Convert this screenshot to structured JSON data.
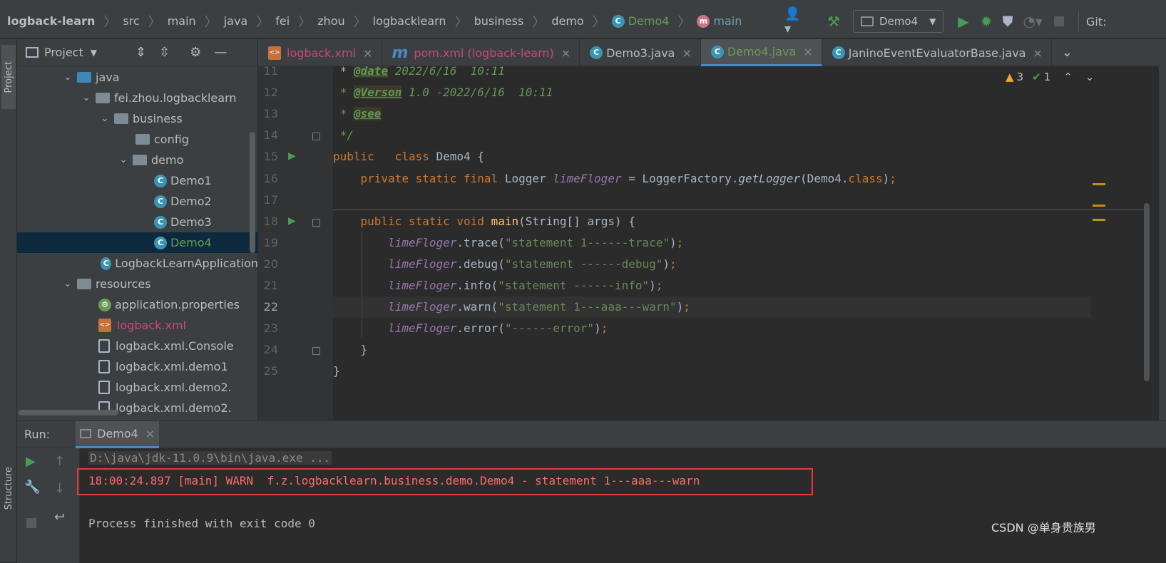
{
  "breadcrumb": {
    "items": [
      "logback-learn",
      "src",
      "main",
      "java",
      "fei",
      "zhou",
      "logbacklearn",
      "business",
      "demo"
    ],
    "class": "Demo4",
    "method": "main"
  },
  "toolbar": {
    "run_config": "Demo4",
    "git_label": "Git:"
  },
  "left_strip": {
    "project_label": "Project",
    "structure_label": "Structure"
  },
  "project": {
    "title": "Project",
    "tree": [
      {
        "label": "java",
        "kind": "folder-blue",
        "depth": 0,
        "expanded": true
      },
      {
        "label": "fei.zhou.logbacklearn",
        "kind": "package",
        "depth": 1,
        "expanded": true
      },
      {
        "label": "business",
        "kind": "package",
        "depth": 2,
        "expanded": true
      },
      {
        "label": "config",
        "kind": "package",
        "depth": 3
      },
      {
        "label": "demo",
        "kind": "package",
        "depth": 3,
        "expanded": true
      },
      {
        "label": "Demo1",
        "kind": "class",
        "depth": 4
      },
      {
        "label": "Demo2",
        "kind": "class",
        "depth": 4
      },
      {
        "label": "Demo3",
        "kind": "class",
        "depth": 4
      },
      {
        "label": "Demo4",
        "kind": "class",
        "depth": 4,
        "selected": true
      },
      {
        "label": "LogbackLearnApplication",
        "kind": "appclass",
        "depth": 2
      },
      {
        "label": "resources",
        "kind": "folder",
        "depth": 0,
        "expanded": true
      },
      {
        "label": "application.properties",
        "kind": "props",
        "depth": 1
      },
      {
        "label": "logback.xml",
        "kind": "xml",
        "depth": 1
      },
      {
        "label": "logback.xml.Console",
        "kind": "file",
        "depth": 1
      },
      {
        "label": "logback.xml.demo1",
        "kind": "file",
        "depth": 1
      },
      {
        "label": "logback.xml.demo2.",
        "kind": "file",
        "depth": 1
      },
      {
        "label": "logback.xml.demo2.",
        "kind": "file",
        "depth": 1
      }
    ]
  },
  "tabs": [
    {
      "label": "logback.xml",
      "kind": "xml"
    },
    {
      "label": "pom.xml (logback-learn)",
      "kind": "maven"
    },
    {
      "label": "Demo3.java",
      "kind": "class"
    },
    {
      "label": "Demo4.java",
      "kind": "class",
      "active": true
    },
    {
      "label": "JaninoEventEvaluatorBase.java",
      "kind": "class"
    }
  ],
  "inspections": {
    "warnings": "3",
    "ok": "1"
  },
  "code_lines": [
    {
      "n": "11",
      "html": " * <span class='tag'>@date</span><span class='cm'> 2022/6/16  10:11</span>"
    },
    {
      "n": "12",
      "html": "<span class='cm'> * </span><span class='tag'>@Verson</span><span class='cm'> 1.0 -2022/6/16  10:11</span>"
    },
    {
      "n": "13",
      "html": "<span class='cm'> * </span><span class='tag'>@see</span>"
    },
    {
      "n": "14",
      "html": "<span class='cm'> */</span>"
    },
    {
      "n": "15",
      "html": "<span class='kw'>public</span>   <span class='kw'>class</span> Demo4 {"
    },
    {
      "n": "16",
      "html": "    <span class='kw'>private static final</span> Logger <span class='fld'>limeFloger</span> = LoggerFactory.<span class='stat'>getLogger</span>(Demo4.<span class='kw'>class</span>)<span class='kw'>;</span>"
    },
    {
      "n": "17",
      "html": ""
    },
    {
      "n": "18",
      "html": "    <span class='kw'>public static void</span> <span class='mth'>main</span>(String[] args) {"
    },
    {
      "n": "19",
      "html": "        <span class='fld'>limeFloger</span>.trace(<span class='str'>\"statement 1------trace\"</span>)<span class='kw'>;</span>"
    },
    {
      "n": "20",
      "html": "        <span class='fld'>limeFloger</span>.debug(<span class='str'>\"statement ------debug\"</span>)<span class='kw'>;</span>"
    },
    {
      "n": "21",
      "html": "        <span class='fld'>limeFloger</span>.info(<span class='str'>\"statement ------info\"</span>)<span class='kw'>;</span>"
    },
    {
      "n": "22",
      "html": "        <span class='fld'>limeFloger</span>.warn(<span class='str'>\"statement 1---aaa---warn\"</span>)<span class='kw'>;</span>"
    },
    {
      "n": "23",
      "html": "        <span class='fld'>limeFloger</span>.error(<span class='str'>\"------error\"</span>)<span class='kw'>;</span>"
    },
    {
      "n": "24",
      "html": "    }"
    },
    {
      "n": "25",
      "html": "}"
    }
  ],
  "current_line": "22",
  "run": {
    "label": "Run:",
    "tab": "Demo4",
    "cmd": "D:\\java\\jdk-11.0.9\\bin\\java.exe ...",
    "warn_line": "18:00:24.897 [main] WARN  f.z.logbacklearn.business.demo.Demo4 - statement 1---aaa---warn",
    "exit": "Process finished with exit code 0"
  },
  "watermark": "CSDN @单身贵族男",
  "colors": {
    "accent": "#4a88c7",
    "warn_text": "#ff6b68",
    "highlight_box": "#e53935"
  }
}
